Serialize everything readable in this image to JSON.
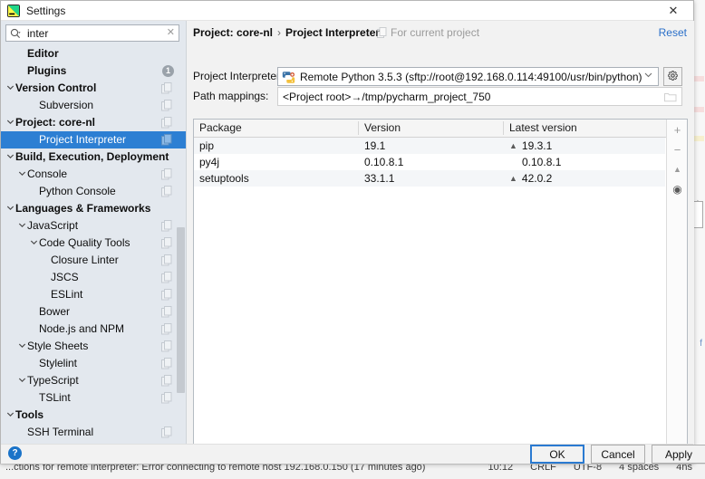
{
  "window": {
    "title": "Settings",
    "app_icon": "pycharm-icon",
    "close_label": "✕"
  },
  "search": {
    "value": "inter",
    "placeholder": "",
    "icon": "search-icon",
    "clear_label": "✕"
  },
  "sidebar": {
    "items": [
      {
        "label": "Editor",
        "indent": 1,
        "bold": true,
        "arrow": "",
        "icon": "",
        "selected": false
      },
      {
        "label": "Plugins",
        "indent": 1,
        "bold": true,
        "arrow": "",
        "icon": "badge",
        "badge": "1",
        "selected": false
      },
      {
        "label": "Version Control",
        "indent": 0,
        "bold": true,
        "arrow": "v",
        "icon": "copy-icon",
        "selected": false
      },
      {
        "label": "Subversion",
        "indent": 2,
        "bold": false,
        "arrow": "",
        "icon": "copy-icon",
        "selected": false
      },
      {
        "label": "Project: core-nl",
        "indent": 0,
        "bold": true,
        "arrow": "v",
        "icon": "copy-icon",
        "selected": false
      },
      {
        "label": "Project Interpreter",
        "indent": 2,
        "bold": false,
        "arrow": "",
        "icon": "copy-icon",
        "selected": true
      },
      {
        "label": "Build, Execution, Deployment",
        "indent": 0,
        "bold": true,
        "arrow": "v",
        "icon": "",
        "selected": false
      },
      {
        "label": "Console",
        "indent": 1,
        "bold": false,
        "arrow": "v",
        "icon": "copy-icon",
        "selected": false
      },
      {
        "label": "Python Console",
        "indent": 2,
        "bold": false,
        "arrow": "",
        "icon": "copy-icon",
        "selected": false
      },
      {
        "label": "Languages & Frameworks",
        "indent": 0,
        "bold": true,
        "arrow": "v",
        "icon": "",
        "selected": false
      },
      {
        "label": "JavaScript",
        "indent": 1,
        "bold": false,
        "arrow": "v",
        "icon": "copy-icon",
        "selected": false
      },
      {
        "label": "Code Quality Tools",
        "indent": 2,
        "bold": false,
        "arrow": "v",
        "icon": "copy-icon",
        "selected": false
      },
      {
        "label": "Closure Linter",
        "indent": 3,
        "bold": false,
        "arrow": "",
        "icon": "copy-icon",
        "selected": false
      },
      {
        "label": "JSCS",
        "indent": 3,
        "bold": false,
        "arrow": "",
        "icon": "copy-icon",
        "selected": false
      },
      {
        "label": "ESLint",
        "indent": 3,
        "bold": false,
        "arrow": "",
        "icon": "copy-icon",
        "selected": false
      },
      {
        "label": "Bower",
        "indent": 2,
        "bold": false,
        "arrow": "",
        "icon": "copy-icon",
        "selected": false
      },
      {
        "label": "Node.js and NPM",
        "indent": 2,
        "bold": false,
        "arrow": "",
        "icon": "copy-icon",
        "selected": false
      },
      {
        "label": "Style Sheets",
        "indent": 1,
        "bold": false,
        "arrow": "v",
        "icon": "copy-icon",
        "selected": false
      },
      {
        "label": "Stylelint",
        "indent": 2,
        "bold": false,
        "arrow": "",
        "icon": "copy-icon",
        "selected": false
      },
      {
        "label": "TypeScript",
        "indent": 1,
        "bold": false,
        "arrow": "v",
        "icon": "copy-icon",
        "selected": false
      },
      {
        "label": "TSLint",
        "indent": 2,
        "bold": false,
        "arrow": "",
        "icon": "copy-icon",
        "selected": false
      },
      {
        "label": "Tools",
        "indent": 0,
        "bold": true,
        "arrow": "v",
        "icon": "",
        "selected": false
      },
      {
        "label": "SSH Terminal",
        "indent": 1,
        "bold": false,
        "arrow": "",
        "icon": "copy-icon",
        "selected": false
      }
    ]
  },
  "main": {
    "breadcrumb_root": "Project: core-nl",
    "breadcrumb_sep": "›",
    "breadcrumb_leaf": "Project Interpreter",
    "for_current_project": "For current project",
    "reset_label": "Reset",
    "interpreter_label": "Project Interpreter:",
    "interpreter_value": "Remote Python 3.5.3 (sftp://root@192.168.0.114:49100/usr/bin/python)",
    "interpreter_chevron": "⌄",
    "gear_icon": "gear-icon",
    "path_label": "Path mappings:",
    "path_value": "<Project root>→/tmp/pycharm_project_750",
    "folder_icon": "folder-icon",
    "table": {
      "columns": [
        "Package",
        "Version",
        "Latest version"
      ],
      "rows": [
        {
          "package": "pip",
          "version": "19.1",
          "latest": "19.3.1",
          "upgradable": true
        },
        {
          "package": "py4j",
          "version": "0.10.8.1",
          "latest": "0.10.8.1",
          "upgradable": false
        },
        {
          "package": "setuptools",
          "version": "33.1.1",
          "latest": "42.0.2",
          "upgradable": true
        }
      ],
      "upgrade_marker": "▲",
      "toolbar": [
        {
          "name": "add-package-button",
          "glyph": "+"
        },
        {
          "name": "remove-package-button",
          "glyph": "−"
        },
        {
          "name": "upgrade-package-button",
          "glyph": "▲"
        },
        {
          "name": "show-early-releases-button",
          "glyph": "◉"
        }
      ]
    }
  },
  "footer": {
    "help_label": "?",
    "ok_label": "OK",
    "cancel_label": "Cancel",
    "apply_label": "Apply"
  },
  "statusbar": {
    "message": "...ctions for remote interpreter: Error connecting to remote host 192.168.0.150 (17 minutes ago)",
    "position": "10:12",
    "line_separator": "CRLF",
    "encoding": "UTF-8",
    "indent": "4 spaces",
    "branch": "4ns"
  },
  "colors": {
    "selection": "#2d7fd3",
    "link": "#2a6fc9",
    "sidebar_bg": "#e3e8ee",
    "dialog_bg": "#f2f2f2",
    "focus_ring": "#2a7ad1"
  }
}
